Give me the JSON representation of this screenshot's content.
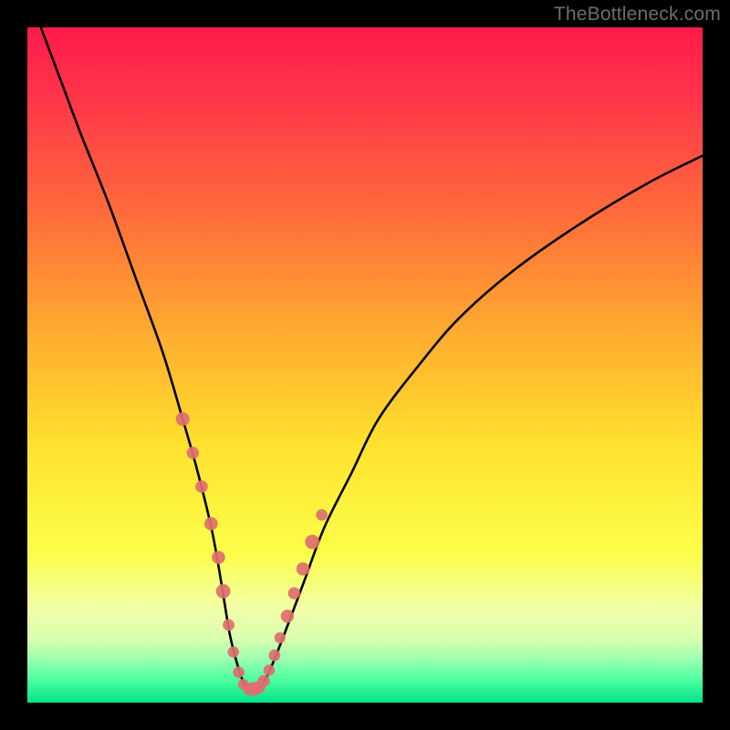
{
  "watermark": "TheBottleneck.com",
  "colors": {
    "frame": "#000000",
    "curve": "#000000",
    "markers": "#de6f6f",
    "gradient_stops": [
      {
        "offset": 0.0,
        "color": "#ff1a4b"
      },
      {
        "offset": 0.12,
        "color": "#ff3a49"
      },
      {
        "offset": 0.28,
        "color": "#ff6d3a"
      },
      {
        "offset": 0.45,
        "color": "#ffab2f"
      },
      {
        "offset": 0.62,
        "color": "#ffe22e"
      },
      {
        "offset": 0.78,
        "color": "#fbff4a"
      },
      {
        "offset": 0.86,
        "color": "#f3ffa8"
      },
      {
        "offset": 0.905,
        "color": "#d9ffae"
      },
      {
        "offset": 0.935,
        "color": "#9dffb0"
      },
      {
        "offset": 0.965,
        "color": "#4fffa2"
      },
      {
        "offset": 1.0,
        "color": "#00e588"
      }
    ]
  },
  "chart_data": {
    "type": "line",
    "title": "",
    "xlabel": "",
    "ylabel": "",
    "xlim": [
      0,
      100
    ],
    "ylim": [
      0,
      100
    ],
    "series": [
      {
        "name": "bottleneck-curve",
        "x": [
          2,
          5,
          8,
          12,
          16,
          20,
          23,
          25,
          27,
          28,
          29,
          30,
          31,
          32,
          33,
          34,
          35,
          36,
          38,
          41,
          44,
          48,
          52,
          58,
          64,
          72,
          82,
          92,
          100
        ],
        "values": [
          100,
          92,
          84,
          74,
          63,
          52,
          42,
          35,
          27,
          22,
          16,
          10,
          6,
          3,
          2,
          2,
          3,
          5,
          10,
          18,
          26,
          34,
          42,
          50,
          57,
          64,
          71,
          77,
          81
        ]
      }
    ],
    "markers": {
      "name": "highlighted-points",
      "x": [
        23.0,
        24.5,
        25.8,
        27.2,
        28.3,
        29.0,
        29.8,
        30.5,
        31.3,
        32.0,
        32.8,
        33.5,
        34.3,
        35.0,
        35.8,
        36.6,
        37.4,
        38.5,
        39.5,
        40.8,
        42.2,
        43.6
      ],
      "values": [
        42.0,
        37.0,
        32.0,
        26.5,
        21.5,
        16.5,
        11.5,
        7.5,
        4.5,
        2.7,
        2.0,
        2.0,
        2.3,
        3.2,
        4.8,
        7.0,
        9.6,
        12.8,
        16.2,
        19.8,
        23.8,
        27.8
      ]
    }
  }
}
